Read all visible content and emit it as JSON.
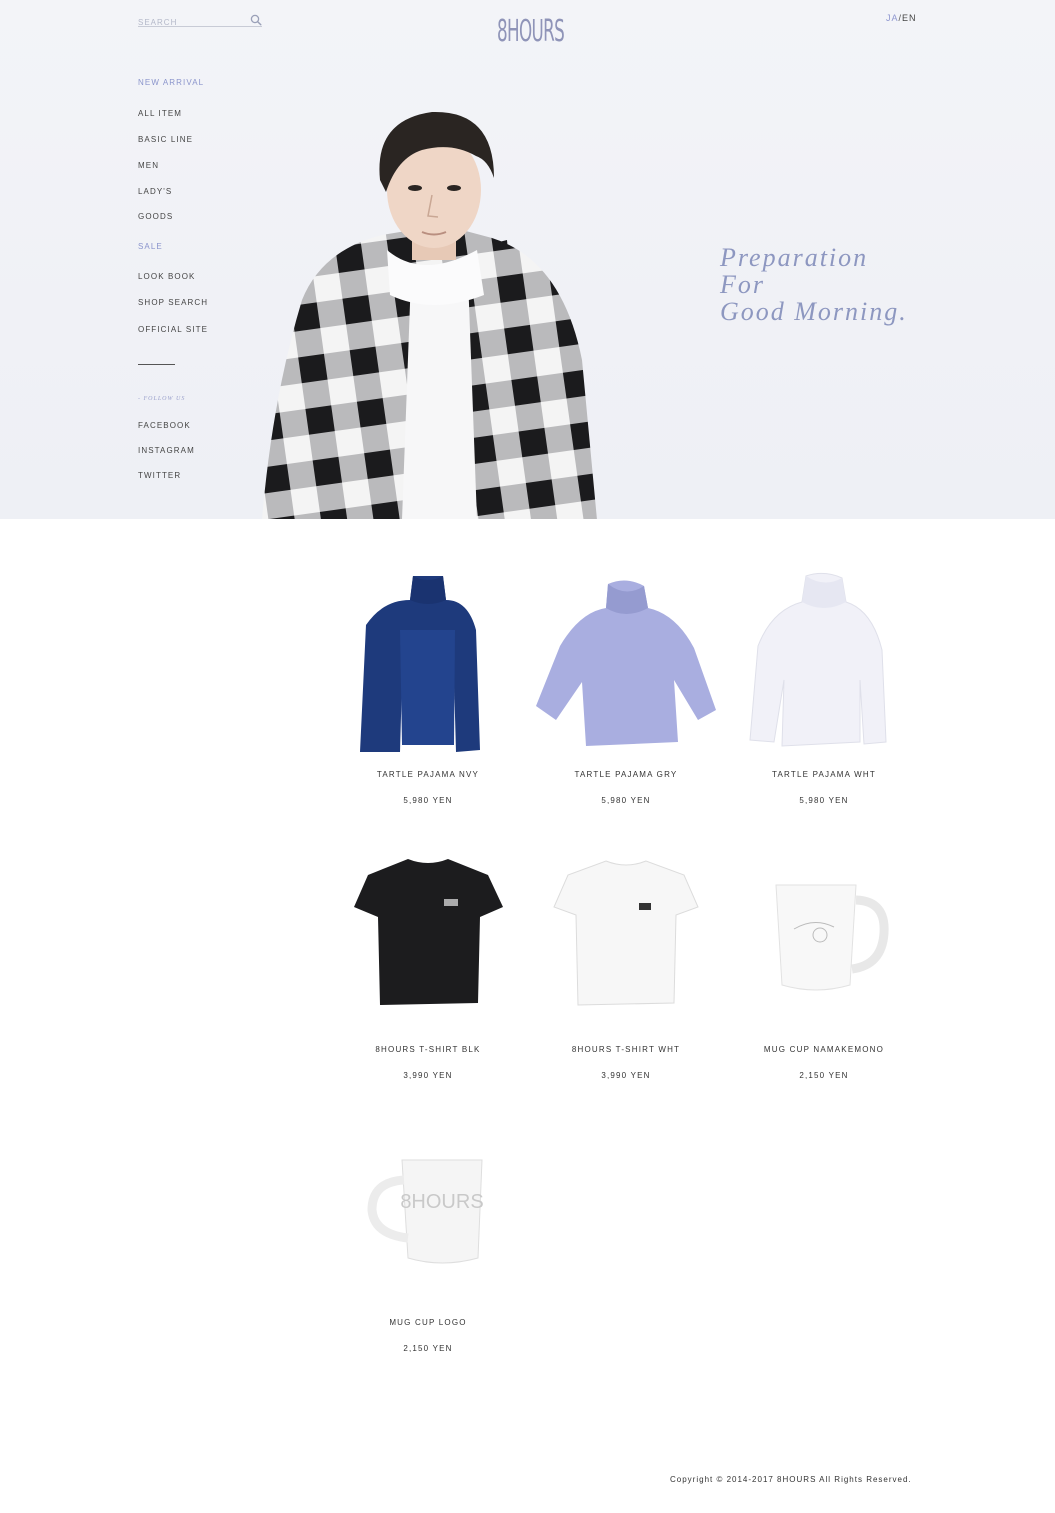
{
  "header": {
    "search_placeholder": "SEARCH",
    "logo": "8HOURS",
    "lang_ja": "JA",
    "lang_sep": "/",
    "lang_en": "EN"
  },
  "nav": {
    "items": [
      {
        "label": "NEW ARRIVAL",
        "accent": true
      },
      {
        "label": "ALL ITEM",
        "accent": false
      },
      {
        "label": "BASIC LINE",
        "accent": false
      },
      {
        "label": "MEN",
        "accent": false
      },
      {
        "label": "LADY'S",
        "accent": false
      },
      {
        "label": "GOODS",
        "accent": false
      },
      {
        "label": "SALE",
        "accent": true
      },
      {
        "label": "LOOK BOOK",
        "accent": false
      },
      {
        "label": "SHOP SEARCH",
        "accent": false
      },
      {
        "label": "OFFICIAL SITE",
        "accent": false
      }
    ],
    "follow_label": "- FOLLOW US",
    "social": [
      "FACEBOOK",
      "INSTAGRAM",
      "TWITTER"
    ]
  },
  "hero": {
    "tagline": [
      "Preparation",
      "For",
      "Good Morning."
    ]
  },
  "products": [
    {
      "name": "TARTLE PAJAMA NVY",
      "price": "5,980 YEN",
      "image": "navy-turtleneck"
    },
    {
      "name": "TARTLE PAJAMA GRY",
      "price": "5,980 YEN",
      "image": "grey-turtleneck"
    },
    {
      "name": "TARTLE PAJAMA WHT",
      "price": "5,980 YEN",
      "image": "white-turtleneck"
    },
    {
      "name": "8HOURS T-SHIRT BLK",
      "price": "3,990 YEN",
      "image": "black-tshirt"
    },
    {
      "name": "8HOURS T-SHIRT WHT",
      "price": "3,990 YEN",
      "image": "white-tshirt"
    },
    {
      "name": "MUG CUP NAMAKEMONO",
      "price": "2,150 YEN",
      "image": "mug-sloth"
    },
    {
      "name": "MUG CUP LOGO",
      "price": "2,150 YEN",
      "image": "mug-logo"
    }
  ],
  "footer": {
    "copyright": "Copyright © 2014-2017 8HOURS All Rights Reserved."
  },
  "colors": {
    "accent": "#8a94cc",
    "logo": "#8f94b8",
    "text": "#333333"
  }
}
